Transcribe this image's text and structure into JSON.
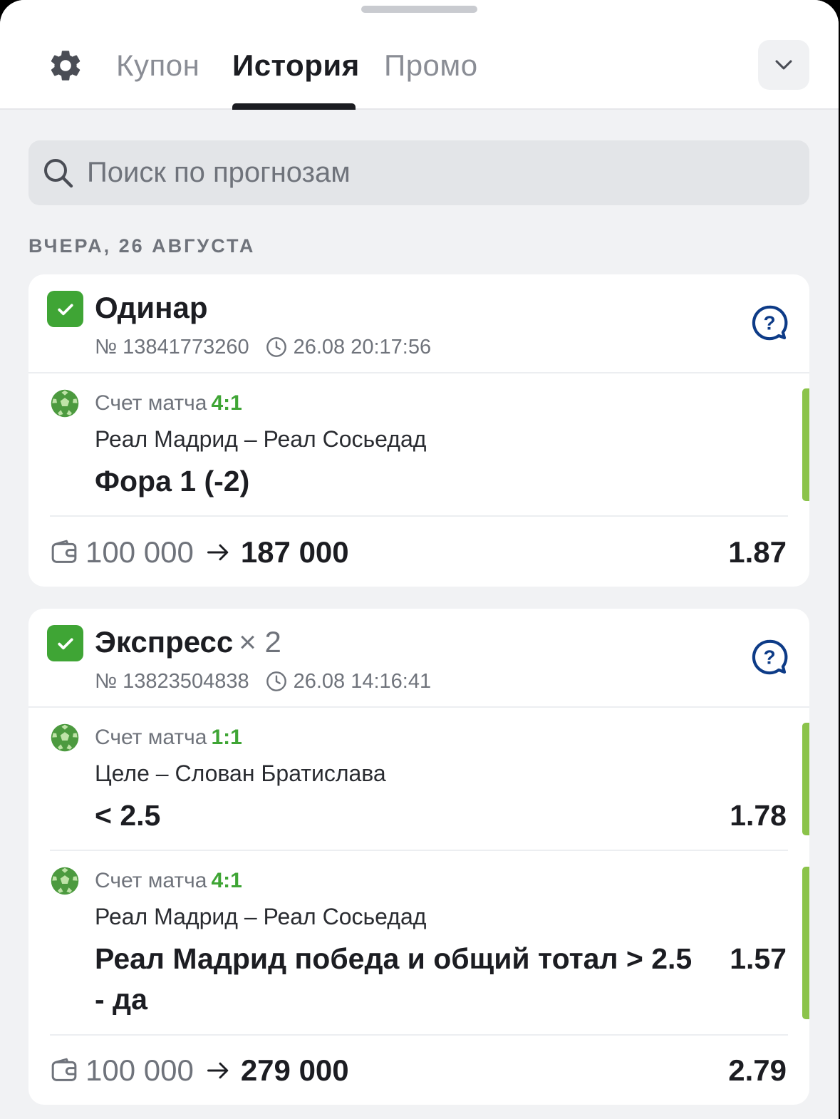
{
  "header": {
    "tabs": [
      {
        "label": "Купон",
        "active": false
      },
      {
        "label": "История",
        "active": true
      },
      {
        "label": "Промо",
        "active": false
      }
    ]
  },
  "search": {
    "placeholder": "Поиск по прогнозам"
  },
  "date_header": "ВЧЕРА, 26 АВГУСТА",
  "colors": {
    "accent_green": "#3fa535",
    "bar_green": "#8bc34a",
    "help_blue": "#0d3b87"
  },
  "bets": [
    {
      "type": "Одинар",
      "multiplier": "",
      "number": "№ 13841773260",
      "time": "26.08 20:17:56",
      "status": "won",
      "selections": [
        {
          "score_label": "Счет матча",
          "score": "4:1",
          "match": "Реал Мадрид – Реал Сосьедад",
          "outcome": "Фора 1 (-2)",
          "coef": ""
        }
      ],
      "stake": "100 000",
      "payout": "187 000",
      "total_coef": "1.87"
    },
    {
      "type": "Экспресс",
      "multiplier": "× 2",
      "number": "№ 13823504838",
      "time": "26.08 14:16:41",
      "status": "won",
      "selections": [
        {
          "score_label": "Счет матча",
          "score": "1:1",
          "match": "Целе – Слован Братислава",
          "outcome": "< 2.5",
          "coef": "1.78"
        },
        {
          "score_label": "Счет матча",
          "score": "4:1",
          "match": "Реал Мадрид – Реал Сосьедад",
          "outcome": "Реал Мадрид победа и общий тотал > 2.5 - да",
          "coef": "1.57"
        }
      ],
      "stake": "100 000",
      "payout": "279 000",
      "total_coef": "2.79"
    }
  ]
}
